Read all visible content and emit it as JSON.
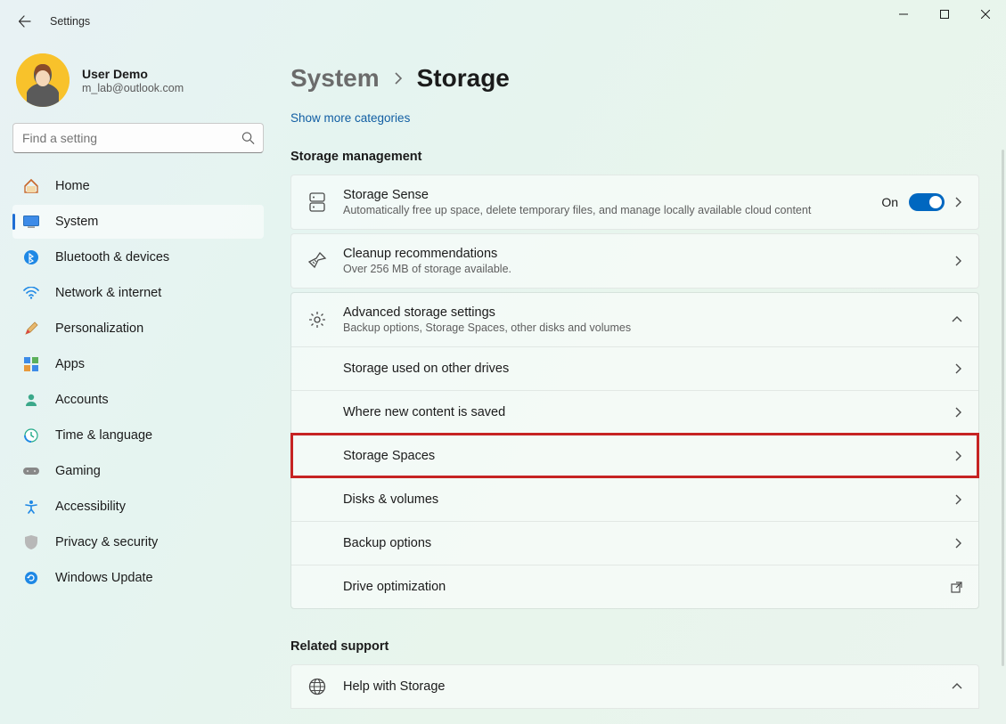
{
  "window": {
    "title": "Settings"
  },
  "profile": {
    "name": "User Demo",
    "email": "m_lab@outlook.com"
  },
  "search": {
    "placeholder": "Find a setting"
  },
  "nav": [
    {
      "label": "Home"
    },
    {
      "label": "System"
    },
    {
      "label": "Bluetooth & devices"
    },
    {
      "label": "Network & internet"
    },
    {
      "label": "Personalization"
    },
    {
      "label": "Apps"
    },
    {
      "label": "Accounts"
    },
    {
      "label": "Time & language"
    },
    {
      "label": "Gaming"
    },
    {
      "label": "Accessibility"
    },
    {
      "label": "Privacy & security"
    },
    {
      "label": "Windows Update"
    }
  ],
  "breadcrumb": {
    "parent": "System",
    "current": "Storage"
  },
  "links": {
    "show_more": "Show more categories"
  },
  "sections": {
    "storage_management": "Storage management",
    "related_support": "Related support"
  },
  "cards": {
    "storage_sense": {
      "title": "Storage Sense",
      "subtitle": "Automatically free up space, delete temporary files, and manage locally available cloud content",
      "toggle_label": "On"
    },
    "cleanup": {
      "title": "Cleanup recommendations",
      "subtitle": "Over 256 MB of storage available."
    },
    "advanced": {
      "title": "Advanced storage settings",
      "subtitle": "Backup options, Storage Spaces, other disks and volumes"
    },
    "help": {
      "title": "Help with Storage"
    }
  },
  "advanced_items": [
    {
      "label": "Storage used on other drives"
    },
    {
      "label": "Where new content is saved"
    },
    {
      "label": "Storage Spaces"
    },
    {
      "label": "Disks & volumes"
    },
    {
      "label": "Backup options"
    },
    {
      "label": "Drive optimization"
    }
  ]
}
